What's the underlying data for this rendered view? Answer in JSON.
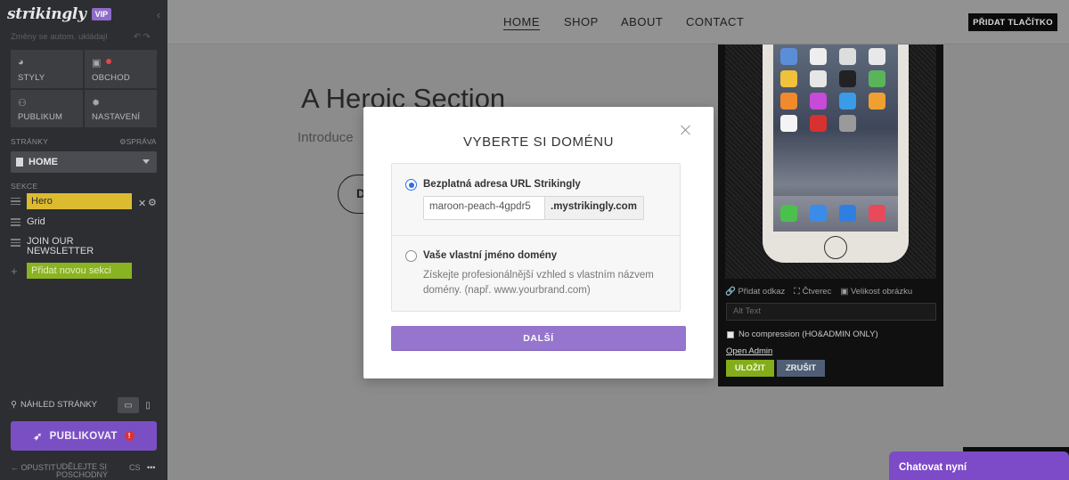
{
  "sidebar": {
    "logo": "strikingly",
    "badge": "VIP",
    "autosave": "Změny se autom. ukládají",
    "undo": "↶ ↷",
    "tiles": [
      {
        "label": "STYLY",
        "icon": "palette-icon"
      },
      {
        "label": "OBCHOD",
        "icon": "bag-icon"
      },
      {
        "label": "PUBLIKUM",
        "icon": "users-icon"
      },
      {
        "label": "NASTAVENÍ",
        "icon": "gear-icon"
      }
    ],
    "pages_label": "STRÁNKY",
    "manage_label": "SPRÁVA",
    "current_page": "HOME",
    "sections_label": "SEKCE",
    "sections": [
      "Hero",
      "Grid",
      "JOIN OUR NEWSLETTER"
    ],
    "add_section": "Přidat novou sekci",
    "preview_label": "NÁHLED STRÁNKY",
    "publish_label": "PUBLIKOVAT",
    "publish_warning": "!",
    "footer": {
      "exit": "OPUSTIT",
      "share": "UDĚLEJTE SI POSCHODNÝ",
      "lang": "CS",
      "more": "•••"
    }
  },
  "site": {
    "nav": [
      "HOME",
      "SHOP",
      "ABOUT",
      "CONTACT"
    ],
    "active_nav": "HOME",
    "add_button": "PŘIDAT TLAČÍTKO",
    "hero_title": "A Heroic Section",
    "hero_sub": "Introduce",
    "hero_button_initial": "D"
  },
  "image_panel": {
    "tools": [
      "Přidat odkaz",
      "Čtverec",
      "Velikost obrázku"
    ],
    "alt_placeholder": "Alt Text",
    "no_compression": "No compression (HO&ADMIN ONLY)",
    "open_admin": "Open Admin",
    "save": "ULOŽIT",
    "cancel": "ZRUŠIT"
  },
  "modal": {
    "title": "VYBERTE SI DOMÉNU",
    "option_free": "Bezplatná adresa URL Strikingly",
    "subdomain_value": "maroon-peach-4gpdr5",
    "subdomain_suffix": ".mystrikingly.com",
    "option_custom": "Vaše vlastní jméno domény",
    "custom_desc": "Získejte profesionálnější vzhled s vlastním názvem domény. (např. www.yourbrand.com)",
    "next": "DALŠÍ",
    "selected_option": "free"
  },
  "chat": {
    "label": "Chatovat nyní"
  },
  "colors": {
    "accent": "#9575cd",
    "publish": "#7b4fc4",
    "hero_section": "#dcbb31",
    "add_section": "#8ab321",
    "radio_selected": "#2f6fe4"
  }
}
